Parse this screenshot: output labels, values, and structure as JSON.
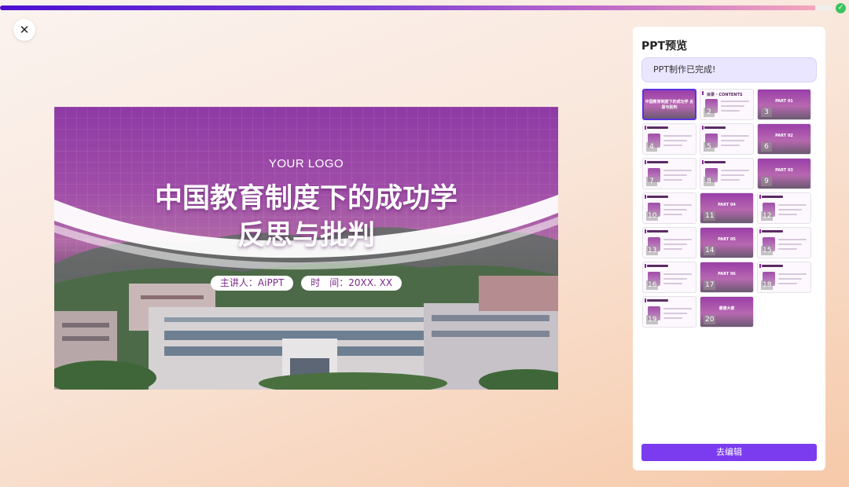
{
  "progress": {
    "percent": 98,
    "status_icon": "check-icon"
  },
  "close_icon": "close-icon",
  "slide": {
    "logo": "YOUR LOGO",
    "title_line1": "中国教育制度下的成功学",
    "title_line2": "反思与批判",
    "presenter": "主讲人：AiPPT",
    "time": "时　间：20XX. XX"
  },
  "panel": {
    "title": "PPT预览",
    "status": "PPT制作已完成!",
    "edit_button": "去编辑",
    "thumbnails": [
      {
        "num": "1",
        "type": "cover",
        "text": "中国教育制度下的成功学 反思与批判"
      },
      {
        "num": "2",
        "type": "content",
        "text": "目录 · CONTENTS"
      },
      {
        "num": "3",
        "type": "cover",
        "text": "PART 01"
      },
      {
        "num": "4",
        "type": "content",
        "text": ""
      },
      {
        "num": "5",
        "type": "content",
        "text": ""
      },
      {
        "num": "6",
        "type": "cover",
        "text": "PART 02"
      },
      {
        "num": "7",
        "type": "content",
        "text": ""
      },
      {
        "num": "8",
        "type": "content",
        "text": ""
      },
      {
        "num": "9",
        "type": "cover",
        "text": "PART 03"
      },
      {
        "num": "10",
        "type": "content",
        "text": ""
      },
      {
        "num": "11",
        "type": "cover",
        "text": "PART 04"
      },
      {
        "num": "12",
        "type": "content",
        "text": ""
      },
      {
        "num": "13",
        "type": "content",
        "text": ""
      },
      {
        "num": "14",
        "type": "cover",
        "text": "PART 05"
      },
      {
        "num": "15",
        "type": "content",
        "text": ""
      },
      {
        "num": "16",
        "type": "content",
        "text": ""
      },
      {
        "num": "17",
        "type": "cover",
        "text": "PART 06"
      },
      {
        "num": "18",
        "type": "content",
        "text": ""
      },
      {
        "num": "19",
        "type": "content",
        "text": ""
      },
      {
        "num": "20",
        "type": "cover",
        "text": "谢谢大家"
      }
    ]
  }
}
